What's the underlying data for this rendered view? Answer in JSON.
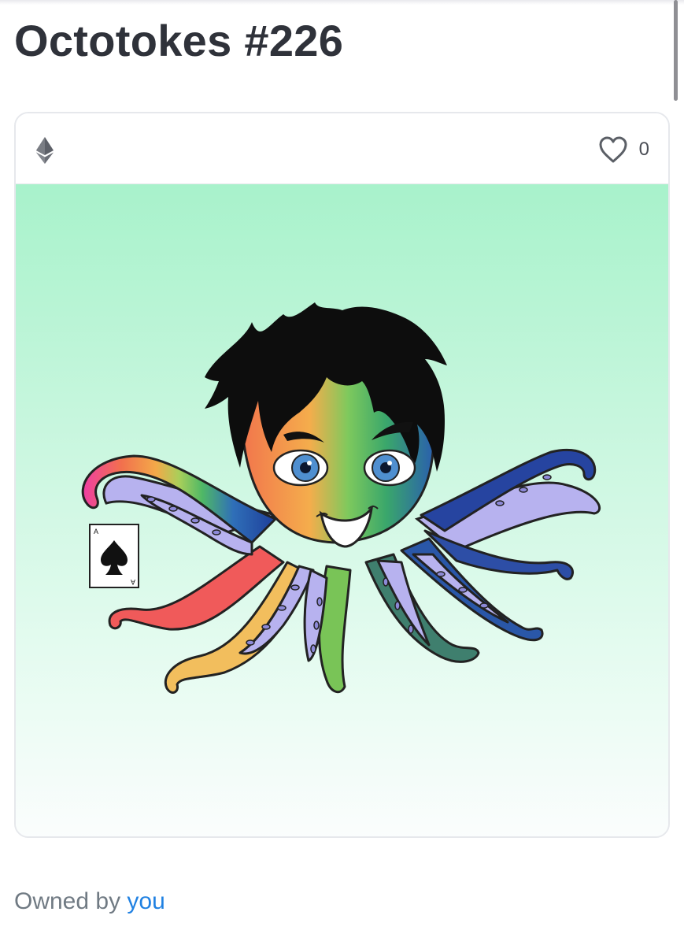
{
  "item": {
    "title": "Octotokes #226",
    "favorites_count": "0",
    "chain_icon": "ethereum-icon",
    "favorite_icon": "heart-icon",
    "artwork": "octopus-illustration-with-ace-of-spades"
  },
  "card": {
    "ace_rank": "A"
  },
  "owner": {
    "prefix": "Owned by",
    "link": "you"
  },
  "colors": {
    "title": "#2f323a",
    "link": "#2081e2",
    "muted": "#707a83",
    "art_bg_top": "#a8f2cb",
    "art_bg_bottom": "#fbfdfd"
  }
}
